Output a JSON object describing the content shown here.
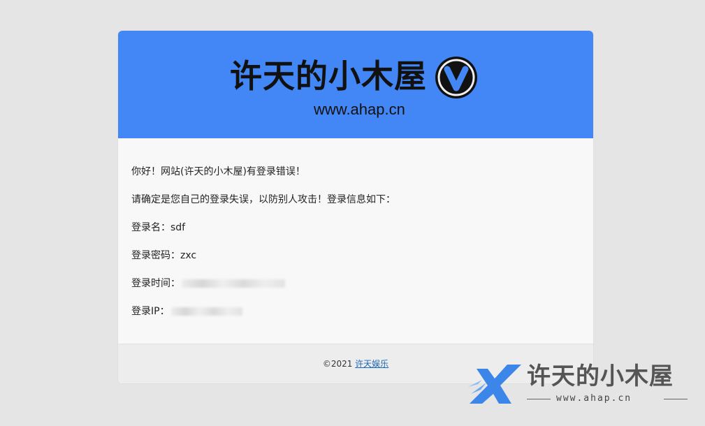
{
  "header": {
    "logo_title": "许天的小木屋",
    "logo_url": "www.ahap.cn",
    "brand_color": "#4287f5"
  },
  "content": {
    "greeting": "你好！网站(许天的小木屋)有登录错误！",
    "notice": "请确定是您自己的登录失误，以防别人攻击！登录信息如下：",
    "login_name_label": "登录名：",
    "login_name_value": "sdf",
    "password_label": "登录密码：",
    "password_value": "zxc",
    "time_label": "登录时间：",
    "ip_label": "登录IP："
  },
  "footer": {
    "copyright": "©2021 ",
    "link_text": "许天娱乐",
    "link_color": "#1a66b8"
  },
  "watermark": {
    "title": "许天的小木屋",
    "url": "www.ahap.cn"
  }
}
